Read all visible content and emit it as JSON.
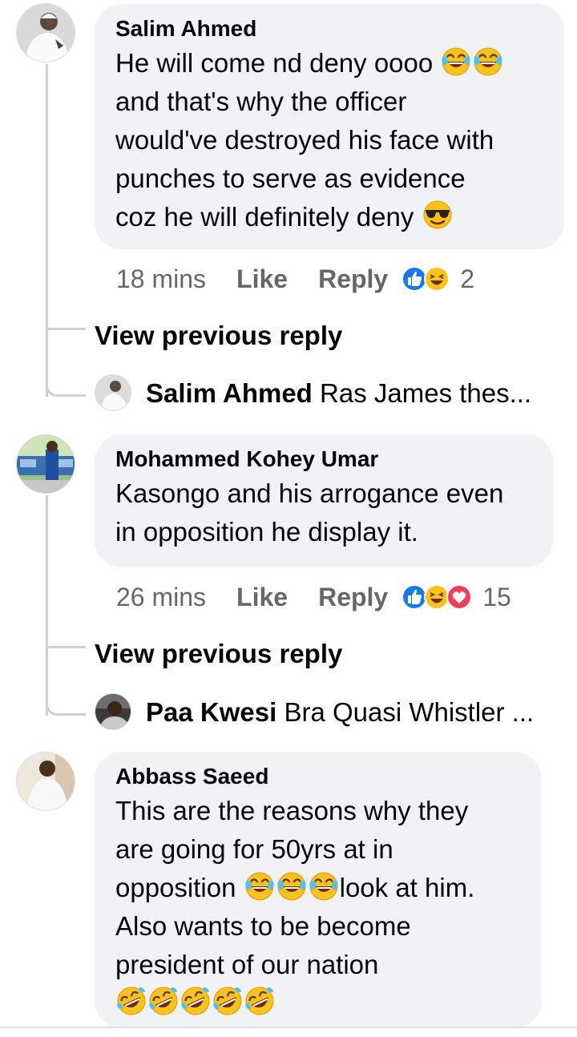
{
  "comments": [
    {
      "author": "Salim Ahmed",
      "text_segments": [
        "He will come nd deny oooo",
        "and that's why the officer",
        "would've destroyed his face with",
        "punches to serve as evidence",
        "coz he will definitely deny"
      ],
      "time": "18 mins",
      "like_label": "Like",
      "reply_label": "Reply",
      "reactions": [
        "like",
        "haha"
      ],
      "reaction_count": "2",
      "view_previous_label": "View previous reply",
      "reply_preview": {
        "author": "Salim Ahmed",
        "text": "Ras James thes..."
      }
    },
    {
      "author": "Mohammed Kohey Umar",
      "text_segments": [
        "Kasongo and his arrogance even",
        "in opposition he display it."
      ],
      "time": "26 mins",
      "like_label": "Like",
      "reply_label": "Reply",
      "reactions": [
        "like",
        "haha",
        "love"
      ],
      "reaction_count": "15",
      "view_previous_label": "View previous reply",
      "reply_preview": {
        "author": "Paa Kwesi",
        "text": "Bra Quasi Whistler ..."
      }
    },
    {
      "author": "Abbass Saeed",
      "text_segments": [
        "This are the reasons why they",
        "are going for 50yrs at in",
        "opposition",
        "look at him.",
        "Also wants to be become",
        "president of our nation"
      ]
    }
  ],
  "colors": {
    "bubble": "#f0f2f5",
    "meta_text": "#65676b",
    "thread_line": "#ced0d4",
    "like_blue": "#1877f2",
    "love_red": "#f33e58",
    "emoji_yellow": "#fcc21b"
  },
  "emoji_names": [
    "face-with-tears-of-joy",
    "smiling-face-with-sunglasses",
    "rolling-on-the-floor-laughing"
  ]
}
